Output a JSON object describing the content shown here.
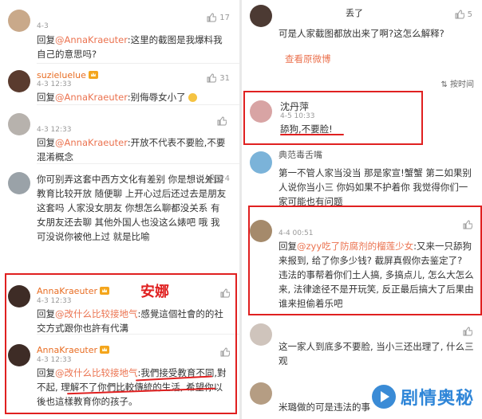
{
  "left": {
    "comments": [
      {
        "username": "",
        "time": "4-3",
        "likes": "17",
        "reply_prefix": "回复",
        "mention": "@AnnaKraeuter",
        "text": ":这里的截图是我爆料我自己的意思吗?"
      },
      {
        "username": "suzieluelue",
        "time": "4-3 12:33",
        "likes": "31",
        "reply_prefix": "回复",
        "mention": "@AnnaKraeuter",
        "text": ":别侮辱女小了"
      },
      {
        "username": "",
        "time": "4-3 12:33",
        "likes": "",
        "reply_prefix": "回复",
        "mention": "@AnnaKraeuter",
        "text": ":开放不代表不要脸,不要混淆概念"
      },
      {
        "username": "",
        "time": "4-3 12:33",
        "likes": "24",
        "reply_prefix": "",
        "mention": "",
        "text": "你可别弄这套中西方文化有差别 你是想说外国教育比较开放 随便聊 上开心过后还过去是朋友这套吗 人家没女朋友 你想怎么聊都没关系 有女朋友还去聊 其他外国人也没这么婊吧 哦 我可没说你被他上过 就是比喻"
      },
      {
        "username": "AnnaKraeuter",
        "time": "4-3 12:33",
        "likes": "",
        "reply_prefix": "回复",
        "mention": "@改什么比较接地气",
        "text": ":感覺這個社會的的社交方式跟你也許有代溝"
      },
      {
        "username": "AnnaKraeuter",
        "time": "4-3 12:33",
        "likes": "",
        "reply_prefix": "回复",
        "mention": "@改什么比较接地气",
        "text": ":我們接受教育不同,對不起, 理解不了你們比較傳統的生活, 希望你以後也這樣教育你的孩子。"
      }
    ],
    "annotation": "安娜"
  },
  "right": {
    "top": {
      "username_tail": "丢了",
      "likes": "5",
      "text": "可是人家截图都放出来了啊?这怎么解释?",
      "link": "查看原微博",
      "sort": "按时间"
    },
    "comments": [
      {
        "username": "沈丹萍",
        "time": "4-5 10:33",
        "likes": "",
        "text": "舔狗,不要脸!"
      },
      {
        "username": "典范毒舌嘴",
        "time": "",
        "likes": "",
        "text": "第一不管人家当没当 那是家宣!蟹蟹 第二如果别人说你当小三 你妈如果不护着你 我觉得你们一家可能也有问题"
      },
      {
        "username": "",
        "time": "4-4 00:51",
        "likes": "",
        "reply_prefix": "回复",
        "mention": "@zyy吃了防腐剂的榴莲少女",
        "text": ":又来一只舔狗来报到, 给了你多少钱? 截屏真假你去鉴定了? 违法的事帮着你们土人搞, 多搞点儿, 怎么大怎么来, 法律途径不是开玩笑, 反正最后搞大了后果由谁来担偷着乐吧"
      },
      {
        "username": "",
        "time": "",
        "likes": "",
        "text": "这一家人到底多不要脸, 当小三还出理了, 什么三观"
      },
      {
        "username": "",
        "time": "",
        "likes": "",
        "text": "米璐做的可是违法的事"
      }
    ]
  },
  "watermark": "剧情奥秘",
  "colors": {
    "mention": "#eb7350",
    "annotation": "#e02020",
    "username": "#e86d23",
    "watermark": "#2f86d8"
  }
}
